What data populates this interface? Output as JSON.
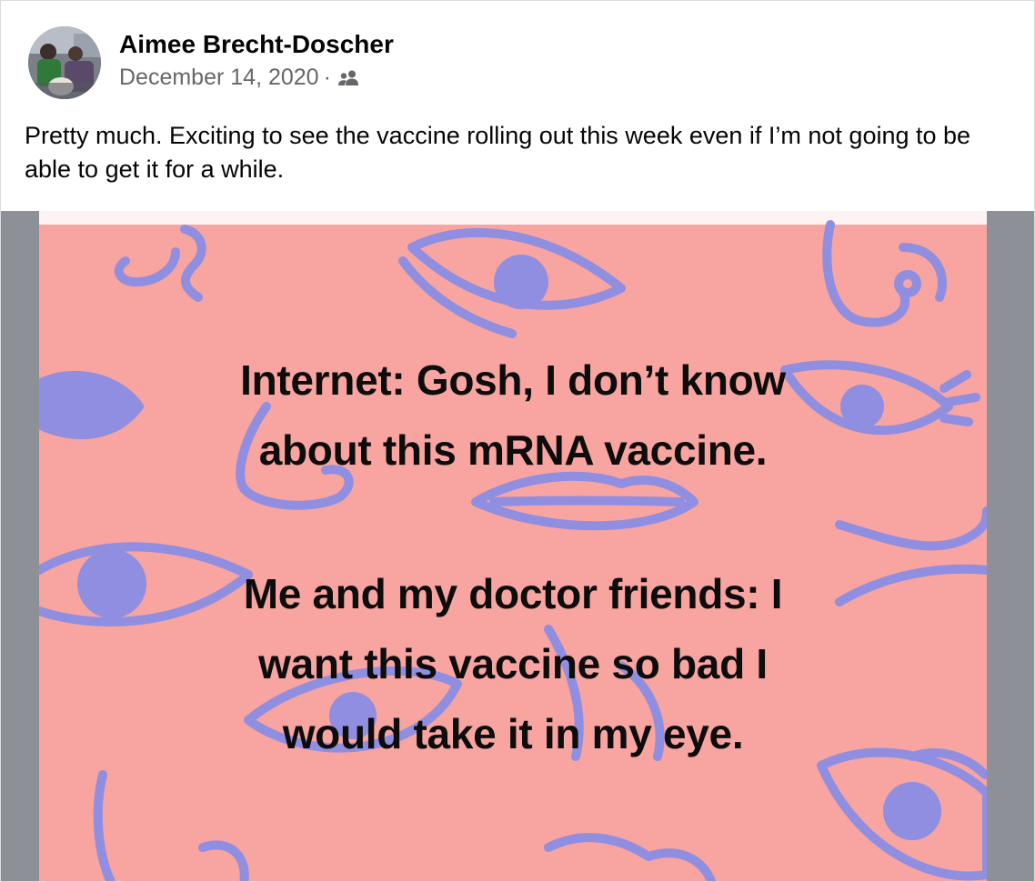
{
  "post": {
    "author": "Aimee Brecht-Doscher",
    "date": "December 14, 2020",
    "separator": "·",
    "audience_icon": "friends-icon",
    "text": "Pretty much. Exciting to see the vaccine rolling out this week even if I’m not going to be able to get it for a while."
  },
  "meme": {
    "line1_a": "Internet: Gosh, I don’t know",
    "line1_b": "about this mRNA vaccine.",
    "line2_a": "Me and my doctor friends: I",
    "line2_b": "want this vaccine so bad I",
    "line2_c": "would take it in my eye.",
    "colors": {
      "background": "#f8a4a0",
      "doodle": "#8f8ee0",
      "text": "#0d0d0d"
    }
  },
  "colors": {
    "name_text": "#050505",
    "secondary_text": "#65676b",
    "media_letterbox": "#8e9097"
  }
}
